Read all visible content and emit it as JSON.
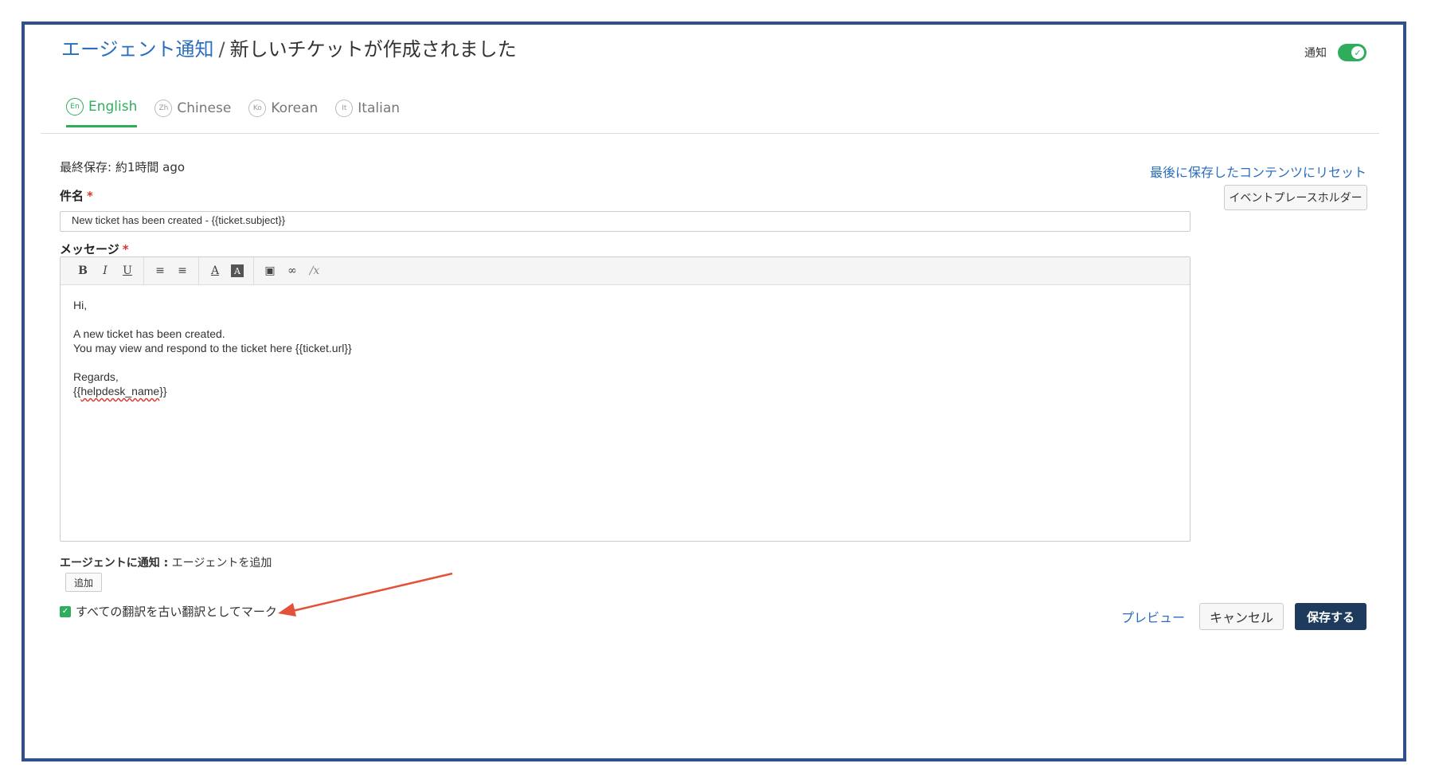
{
  "header": {
    "breadcrumb_parent": "エージェント通知",
    "separator": "/",
    "title": "新しいチケットが作成されました",
    "notify_label": "通知"
  },
  "tabs": [
    {
      "code": "En",
      "label": "English",
      "active": true
    },
    {
      "code": "Zh",
      "label": "Chinese",
      "active": false
    },
    {
      "code": "Ko",
      "label": "Korean",
      "active": false
    },
    {
      "code": "It",
      "label": "Italian",
      "active": false
    }
  ],
  "form": {
    "last_saved": "最終保存: 約1時間 ago",
    "reset_link": "最後に保存したコンテンツにリセット",
    "subject_label": "件名",
    "required_mark": "*",
    "placeholder_button": "イベントプレースホルダー",
    "subject_value": "New ticket has been created - {{ticket.subject}}",
    "message_label": "メッセージ"
  },
  "toolbar": {
    "bold": "B",
    "italic": "I",
    "underline": "U",
    "bullet_list": "≡",
    "numbered_list": "≡",
    "font_color": "A",
    "bg_color": "A",
    "image": "▣",
    "link": "∞",
    "clear_format": "∕x"
  },
  "editor": {
    "line1": "Hi,",
    "line2": "",
    "line3": "A new ticket has been created.",
    "line4": "You may view and respond to the ticket here {{ticket.url}}",
    "line5": "",
    "line6": "Regards,",
    "line7_prefix": "{{",
    "line7_word": "helpdesk_name",
    "line7_suffix": "}}"
  },
  "agents": {
    "label": "エージェントに通知 :",
    "hint": "エージェントを追加",
    "add_button": "追加"
  },
  "mark_outdated": {
    "checked": true,
    "label": "すべての翻訳を古い翻訳としてマーク"
  },
  "actions": {
    "preview": "プレビュー",
    "cancel": "キャンセル",
    "save": "保存する"
  },
  "colors": {
    "accent_green": "#2eae5d",
    "link_blue": "#2a6ebd",
    "primary_button": "#1e3a5c",
    "annotation_arrow": "#e4513a",
    "frame_border": "#2f4f8f"
  }
}
